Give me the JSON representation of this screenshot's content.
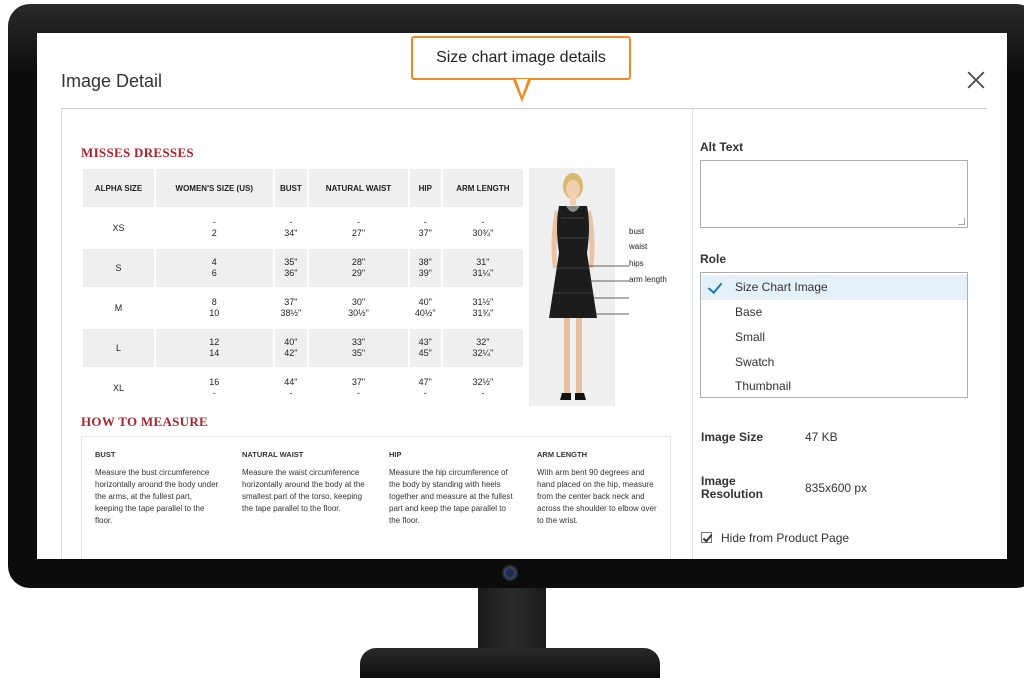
{
  "callout": {
    "text": "Size chart image details",
    "border_color": "#f08a24"
  },
  "modal": {
    "title": "Image Detail"
  },
  "size_chart": {
    "heading": "MISSES DRESSES",
    "columns": [
      "ALPHA SIZE",
      "WOMEN'S SIZE (US)",
      "BUST",
      "NATURAL WAIST",
      "HIP",
      "ARM LENGTH"
    ],
    "rows": [
      [
        "XS",
        "-\n2",
        "-\n34\"",
        "-\n27\"",
        "-\n37\"",
        "-\n30¾\""
      ],
      [
        "S",
        "4\n6",
        "35\"\n36\"",
        "28\"\n29\"",
        "38\"\n39\"",
        "31\"\n31¼\""
      ],
      [
        "M",
        "8\n10",
        "37\"\n38½\"",
        "30\"\n30½\"",
        "40\"\n40½\"",
        "31½\"\n31¾\""
      ],
      [
        "L",
        "12\n14",
        "40\"\n42\"",
        "33\"\n35\"",
        "43\"\n45\"",
        "32\"\n32¼\""
      ],
      [
        "XL",
        "16\n-",
        "44\"\n-",
        "37\"\n-",
        "47\"\n-",
        "32½\"\n-"
      ]
    ],
    "measure_labels": [
      "bust",
      "waist",
      "hips",
      "arm length"
    ],
    "how_to_heading": "HOW TO MEASURE",
    "how_to": [
      {
        "title": "BUST",
        "text": "Measure the bust circumference horizontally around the body under the arms, at the fullest part, keeping the tape parallel to the floor."
      },
      {
        "title": "NATURAL WAIST",
        "text": "Measure the waist circumference horizontally around the body at the smallest part of the torso, keeping the tape parallel to the floor."
      },
      {
        "title": "HIP",
        "text": "Measure the hip circumference of the body by standing with heels together and measure at the fullest part and keep the tape parallel to the floor."
      },
      {
        "title": "ARM LENGTH",
        "text": "With arm bent 90 degrees and hand placed on the hip, measure from the center back neck and across the shoulder to elbow over to the wrist."
      }
    ],
    "accent_color": "#a8252d"
  },
  "alt_text": {
    "label": "Alt Text",
    "value": ""
  },
  "role": {
    "label": "Role",
    "options": [
      "Size Chart Image",
      "Base",
      "Small",
      "Swatch",
      "Thumbnail"
    ],
    "selected": "Size Chart Image",
    "selected_bg": "#e5f1fa",
    "check_color": "#1979c3"
  },
  "image_size": {
    "label": "Image Size",
    "value": "47 KB"
  },
  "image_resolution": {
    "label": "Image\nResolution",
    "value": "835x600 px"
  },
  "hide_from_product": {
    "label": "Hide from Product Page",
    "checked": true
  }
}
